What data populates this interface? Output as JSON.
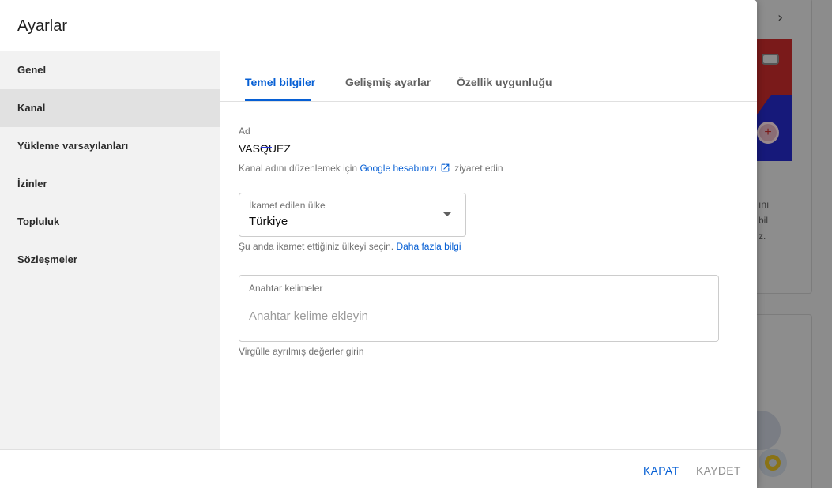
{
  "dialog": {
    "title": "Ayarlar"
  },
  "sidebar": {
    "items": [
      {
        "label": "Genel"
      },
      {
        "label": "Kanal",
        "active": true
      },
      {
        "label": "Yükleme varsayılanları"
      },
      {
        "label": "İzinler"
      },
      {
        "label": "Topluluk"
      },
      {
        "label": "Sözleşmeler"
      }
    ]
  },
  "tabs": [
    {
      "label": "Temel bilgiler",
      "active": true
    },
    {
      "label": "Gelişmiş ayarlar"
    },
    {
      "label": "Özellik uygunluğu"
    }
  ],
  "name_field": {
    "label": "Ad",
    "value": "VASQUEZ",
    "help_prefix": "Kanal adını düzenlemek için",
    "help_link": "Google hesabınızı",
    "help_suffix": "ziyaret edin"
  },
  "country_field": {
    "label": "İkamet edilen ülke",
    "value": "Türkiye",
    "help_prefix": "Şu anda ikamet ettiğiniz ülkeyi seçin.",
    "help_link": "Daha fazla bilgi"
  },
  "keywords_field": {
    "label": "Anahtar kelimeler",
    "placeholder": "Anahtar kelime ekleyin",
    "help": "Virgülle ayrılmış değerler girin"
  },
  "footer": {
    "close_label": "KAPAT",
    "save_label": "KAYDET"
  },
  "colors": {
    "accent": "#065fd4",
    "disabled": "#909090"
  },
  "background": {
    "text_fragments": [
      "ını",
      "bil",
      "z."
    ]
  }
}
